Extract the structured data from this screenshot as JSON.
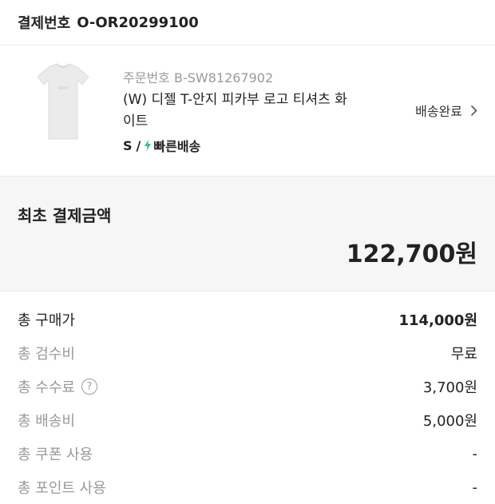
{
  "payment_header": {
    "label": "결제번호",
    "number": "O-OR20299100"
  },
  "product": {
    "image_icon": "tshirt-thumbnail",
    "order_label": "주문번호",
    "order_number": "B-SW81267902",
    "name": "(W) 디젤 T-안지 피카부 로고 티셔츠 화이트",
    "size": "S",
    "separator": "/",
    "delivery_icon": "lightning-bolt-icon",
    "delivery": "빠른배송",
    "status": "배송완료"
  },
  "summary": {
    "title": "최초 결제금액",
    "amount": "122,700원"
  },
  "rows": [
    {
      "label": "총 구매가",
      "value": "114,000원"
    },
    {
      "label": "총 검수비",
      "value": "무료"
    },
    {
      "label": "총 수수료",
      "value": "3,700원",
      "help_icon": "question-circle-icon"
    },
    {
      "label": "총 배송비",
      "value": "5,000원"
    },
    {
      "label": "총 쿠폰 사용",
      "value": "-"
    },
    {
      "label": "총 포인트 사용",
      "value": "-"
    }
  ],
  "colors": {
    "accent_green": "#31c48d",
    "muted_text": "#9a9a9a",
    "panel_bg": "#f6f6f6"
  }
}
